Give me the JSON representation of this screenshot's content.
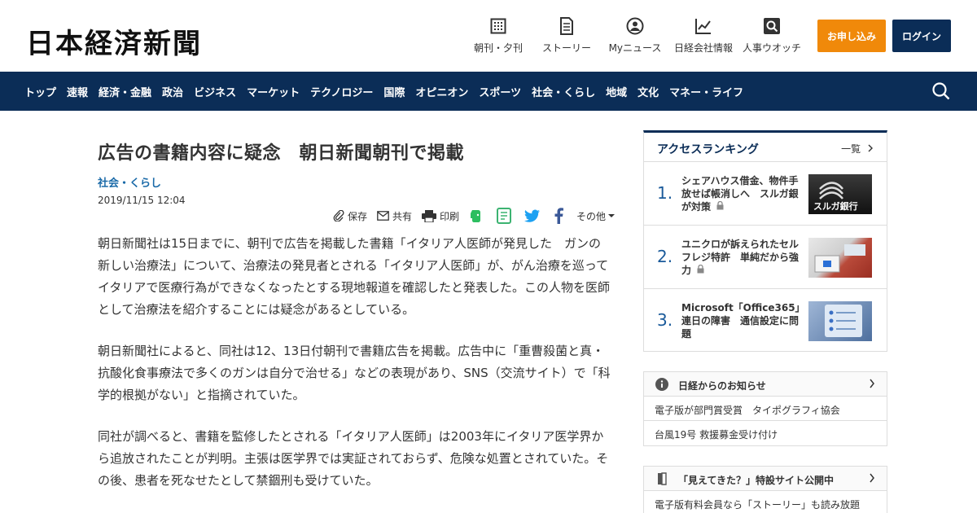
{
  "header": {
    "logo": "日本経済新聞",
    "nav": [
      {
        "label": "朝刊・夕刊",
        "icon": "newspaper-icon"
      },
      {
        "label": "ストーリー",
        "icon": "document-icon"
      },
      {
        "label": "Myニュース",
        "icon": "user-icon"
      },
      {
        "label": "日経会社情報",
        "icon": "chart-icon"
      },
      {
        "label": "人事ウオッチ",
        "icon": "search-person-icon"
      }
    ],
    "subscribe_label": "お申し込み",
    "login_label": "ログイン",
    "colors": {
      "navy": "#0b2d57",
      "orange": "#f0890a"
    }
  },
  "categories": [
    "トップ",
    "速報",
    "経済・金融",
    "政治",
    "ビジネス",
    "マーケット",
    "テクノロジー",
    "国際",
    "オピニオン",
    "スポーツ",
    "社会・くらし",
    "地域",
    "文化",
    "マネー・ライフ"
  ],
  "article": {
    "title": "広告の書籍内容に疑念　朝日新聞朝刊で掲載",
    "category": "社会・くらし",
    "date": "2019/11/15 12:04",
    "share": {
      "save": "保存",
      "share": "共有",
      "print": "印刷",
      "other": "その他"
    },
    "paragraphs": [
      "朝日新聞社は15日までに、朝刊で広告を掲載した書籍「イタリア人医師が発見した　ガンの新しい治療法」について、治療法の発見者とされる「イタリア人医師」が、がん治療を巡ってイタリアで医療行為ができなくなったとする現地報道を確認したと発表した。この人物を医師として治療法を紹介することには疑念があるとしている。",
      "朝日新聞社によると、同社は12、13日付朝刊で書籍広告を掲載。広告中に「重曹殺菌と真・抗酸化食事療法で多くのガンは自分で治せる」などの表現があり、SNS（交流サイト）で「科学的根拠がない」と指摘されていた。",
      "同社が調べると、書籍を監修したとされる「イタリア人医師」は2003年にイタリア医学界から追放されたことが判明。主張は医学界では実証されておらず、危険な処置とされていた。その後、患者を死なせたとして禁錮刑も受けていた。"
    ]
  },
  "ranking": {
    "title": "アクセスランキング",
    "more": "一覧",
    "items": [
      {
        "rank": "1.",
        "text": "シェアハウス借金、物件手放せば帳消しへ　スルガ銀が対策",
        "thumb_text": "スルガ銀行"
      },
      {
        "rank": "2.",
        "text": "ユニクロが訴えられたセルフレジ特許　単純だから強力"
      },
      {
        "rank": "3.",
        "text": "Microsoft「Office365」連日の障害　通信設定に問題"
      }
    ]
  },
  "notice1": {
    "title": "日経からのお知らせ",
    "items": [
      "電子版が部門賞受賞　タイポグラフィ協会",
      "台風19号 救援募金受け付け"
    ]
  },
  "notice2": {
    "title": "「見えてきた？」特設サイト公開中",
    "items": [
      "電子版有料会員なら「ストーリー」も読み放題"
    ]
  }
}
